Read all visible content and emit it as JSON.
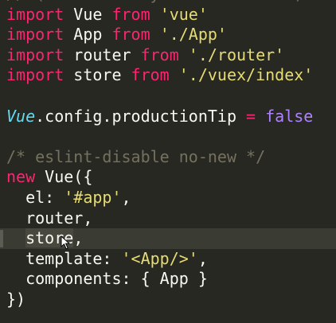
{
  "editor": {
    "language": "javascript",
    "theme_colors": {
      "background": "#272822",
      "keyword": "#F92672",
      "string": "#E6DB74",
      "comment": "#75715E",
      "builtin": "#66D9EF",
      "boolean": "#AE81FF",
      "text": "#F8F8F2"
    },
    "lines": [
      [
        {
          "t": "// (runtime-only or standalone) has",
          "c": "tok-comment"
        }
      ],
      [
        {
          "t": "import",
          "c": "tok-kw"
        },
        {
          "t": " Vue ",
          "c": "tok-plain"
        },
        {
          "t": "from",
          "c": "tok-kw"
        },
        {
          "t": " ",
          "c": "tok-plain"
        },
        {
          "t": "'vue'",
          "c": "tok-str"
        }
      ],
      [
        {
          "t": "import",
          "c": "tok-kw"
        },
        {
          "t": " App ",
          "c": "tok-plain"
        },
        {
          "t": "from",
          "c": "tok-kw"
        },
        {
          "t": " ",
          "c": "tok-plain"
        },
        {
          "t": "'./App'",
          "c": "tok-str"
        }
      ],
      [
        {
          "t": "import",
          "c": "tok-kw"
        },
        {
          "t": " router ",
          "c": "tok-plain"
        },
        {
          "t": "from",
          "c": "tok-kw"
        },
        {
          "t": " ",
          "c": "tok-plain"
        },
        {
          "t": "'./router'",
          "c": "tok-str"
        }
      ],
      [
        {
          "t": "import",
          "c": "tok-kw"
        },
        {
          "t": " store ",
          "c": "tok-plain"
        },
        {
          "t": "from",
          "c": "tok-kw"
        },
        {
          "t": " ",
          "c": "tok-plain"
        },
        {
          "t": "'./vuex/index'",
          "c": "tok-str"
        }
      ],
      [],
      [
        {
          "t": "Vue",
          "c": "tok-builtin"
        },
        {
          "t": ".config.productionTip ",
          "c": "tok-plain"
        },
        {
          "t": "=",
          "c": "tok-kw"
        },
        {
          "t": " ",
          "c": "tok-plain"
        },
        {
          "t": "false",
          "c": "tok-bool"
        }
      ],
      [],
      [
        {
          "t": "/* eslint-disable no-new */",
          "c": "tok-comment"
        }
      ],
      [
        {
          "t": "new",
          "c": "tok-kw"
        },
        {
          "t": " Vue({",
          "c": "tok-plain"
        }
      ],
      [
        {
          "t": "  el: ",
          "c": "tok-plain"
        },
        {
          "t": "'#app'",
          "c": "tok-str"
        },
        {
          "t": ",",
          "c": "tok-plain"
        }
      ],
      [
        {
          "t": "  router,",
          "c": "tok-plain"
        }
      ],
      [
        {
          "t": "  ",
          "c": "tok-plain"
        },
        {
          "t": "store",
          "c": "tok-plain selection"
        },
        {
          "t": ",",
          "c": "tok-plain"
        }
      ],
      [
        {
          "t": "  template: ",
          "c": "tok-plain"
        },
        {
          "t": "'<App/>'",
          "c": "tok-str"
        },
        {
          "t": ",",
          "c": "tok-plain"
        }
      ],
      [
        {
          "t": "  components: { App }",
          "c": "tok-plain"
        }
      ],
      [
        {
          "t": "})",
          "c": "tok-plain"
        }
      ]
    ],
    "active_line_index": 12
  }
}
